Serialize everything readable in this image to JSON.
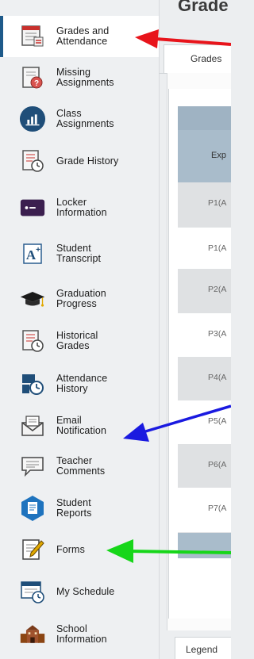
{
  "sidebar": {
    "items": [
      {
        "label": "Grades and\nAttendance",
        "icon": "grades-attendance-icon",
        "active": true
      },
      {
        "label": "Missing\nAssignments",
        "icon": "missing-assignments-icon",
        "active": false
      },
      {
        "label": "Class\nAssignments",
        "icon": "class-assignments-icon",
        "active": false
      },
      {
        "label": "Grade History",
        "icon": "grade-history-icon",
        "active": false
      },
      {
        "label": "Locker\nInformation",
        "icon": "locker-icon",
        "active": false
      },
      {
        "label": "Student\nTranscript",
        "icon": "transcript-icon",
        "active": false
      },
      {
        "label": "Graduation\nProgress",
        "icon": "graduation-cap-icon",
        "active": false
      },
      {
        "label": "Historical\nGrades",
        "icon": "historical-grades-icon",
        "active": false
      },
      {
        "label": "Attendance\nHistory",
        "icon": "attendance-history-icon",
        "active": false
      },
      {
        "label": "Email\nNotification",
        "icon": "email-notification-icon",
        "active": false
      },
      {
        "label": "Teacher\nComments",
        "icon": "teacher-comments-icon",
        "active": false
      },
      {
        "label": "Student\nReports",
        "icon": "student-reports-icon",
        "active": false
      },
      {
        "label": "Forms",
        "icon": "forms-icon",
        "active": false
      },
      {
        "label": "My Schedule",
        "icon": "schedule-icon",
        "active": false
      },
      {
        "label": "School\nInformation",
        "icon": "school-icon",
        "active": false
      }
    ]
  },
  "main": {
    "title": "Grade",
    "tabs": [
      {
        "label": "Grades"
      }
    ],
    "table": {
      "header": "Exp",
      "rows": [
        "P1(A",
        "P1(A",
        "P2(A",
        "P3(A",
        "P4(A",
        "P5(A",
        "P6(A",
        "P7(A"
      ]
    },
    "legend_label": "Legend"
  },
  "annotations": {
    "arrows": [
      {
        "color": "#e8141b",
        "points_to": "Grades and Attendance"
      },
      {
        "color": "#1a1ae0",
        "points_to": "Email Notification"
      },
      {
        "color": "#16d619",
        "points_to": "Forms"
      }
    ]
  }
}
